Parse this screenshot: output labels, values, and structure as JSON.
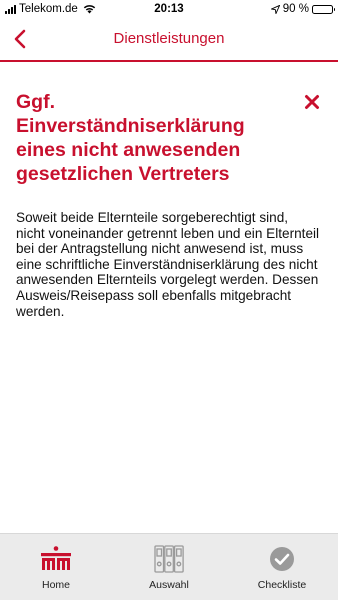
{
  "status_bar": {
    "carrier": "Telekom.de",
    "time": "20:13",
    "battery": "90 %",
    "battery_level": 0.9
  },
  "nav": {
    "title": "Dienstleistungen"
  },
  "detail": {
    "title": "Ggf. Einverständniserklärung eines nicht anwesenden gesetzlichen Vertreters",
    "body": "Soweit beide Elternteile sorgeberechtigt sind, nicht voneinander getrennt leben und ein Elternteil bei der Antragstellung nicht anwesend ist, muss eine schriftliche Einverständniserklärung des nicht anwesenden Elternteils vorgelegt werden. Dessen Ausweis/Reisepass soll ebenfalls mitgebracht werden."
  },
  "tabs": [
    {
      "label": "Home",
      "icon": "city-logo-icon",
      "active": true
    },
    {
      "label": "Auswahl",
      "icon": "binders-icon",
      "active": false
    },
    {
      "label": "Checkliste",
      "icon": "checkmark-circle-icon",
      "active": false
    }
  ],
  "colors": {
    "accent": "#c8102e",
    "tab_bar_bg": "#ebebeb",
    "inactive_icon": "#9a9a9a"
  }
}
